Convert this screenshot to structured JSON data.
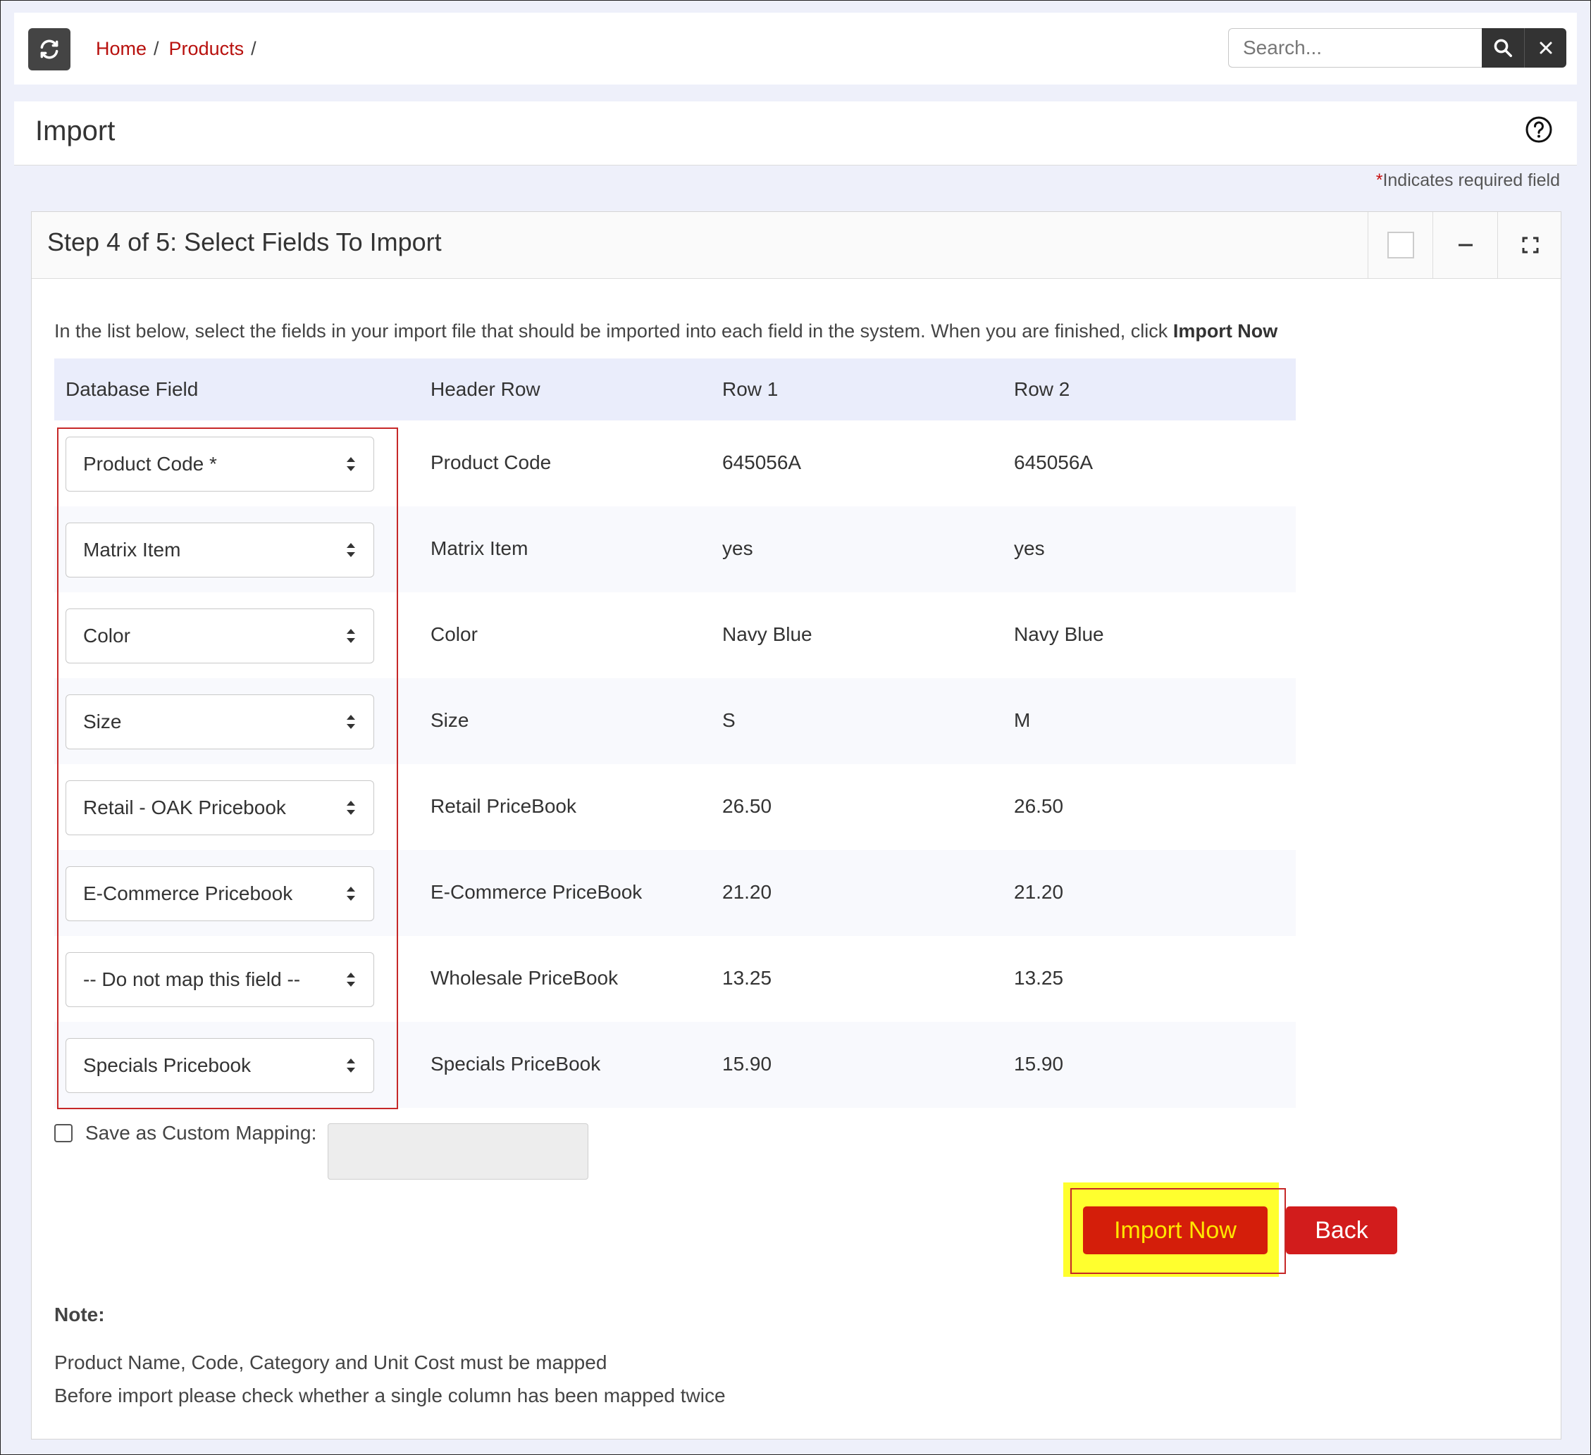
{
  "breadcrumb": {
    "home": "Home",
    "products": "Products",
    "sep": "/"
  },
  "search": {
    "placeholder": "Search..."
  },
  "page": {
    "title": "Import",
    "required_note": "Indicates required field",
    "required_star": "*"
  },
  "panel": {
    "title": "Step 4 of 5: Select Fields To Import",
    "intro_text": "In the list below, select the fields in your import file that should be imported into each field in the system. When you are finished, click ",
    "intro_bold": "Import Now"
  },
  "table": {
    "headers": {
      "db_field": "Database Field",
      "header_row": "Header Row",
      "row1": "Row 1",
      "row2": "Row 2"
    },
    "rows": [
      {
        "field": "Product Code *",
        "header": "Product Code",
        "row1": "645056A",
        "row2": "645056A"
      },
      {
        "field": "Matrix Item",
        "header": "Matrix Item",
        "row1": "yes",
        "row2": "yes"
      },
      {
        "field": "Color",
        "header": "Color",
        "row1": "Navy Blue",
        "row2": "Navy Blue"
      },
      {
        "field": "Size",
        "header": "Size",
        "row1": "S",
        "row2": "M"
      },
      {
        "field": "Retail - OAK Pricebook",
        "header": "Retail PriceBook",
        "row1": "26.50",
        "row2": "26.50"
      },
      {
        "field": "E-Commerce Pricebook",
        "header": "E-Commerce PriceBook",
        "row1": "21.20",
        "row2": "21.20"
      },
      {
        "field": "-- Do not map this field --",
        "header": "Wholesale PriceBook",
        "row1": "13.25",
        "row2": "13.25"
      },
      {
        "field": "Specials Pricebook",
        "header": "Specials PriceBook",
        "row1": "15.90",
        "row2": "15.90"
      }
    ]
  },
  "save_mapping": {
    "label": "Save as Custom Mapping:"
  },
  "buttons": {
    "import_now": "Import Now",
    "back": "Back"
  },
  "notes": {
    "title": "Note:",
    "lines": [
      "Product Name, Code, Category and Unit Cost must be mapped",
      "Before import please check whether a single column has been mapped twice"
    ]
  },
  "colors": {
    "accent_red": "#d21c1c",
    "link_red": "#b8100d",
    "highlight_yellow": "#ffff2e",
    "header_bg": "#eaedfb"
  }
}
